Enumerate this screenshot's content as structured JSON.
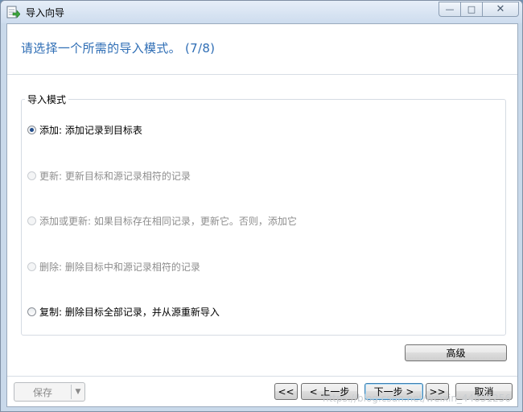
{
  "window": {
    "title": "导入向导",
    "controls": {
      "minimize": "—",
      "maximize": "□",
      "close": "✕"
    }
  },
  "heading": "请选择一个所需的导入模式。 (7/8)",
  "import_mode": {
    "group_label": "导入模式",
    "options": [
      {
        "label": "添加: 添加记录到目标表",
        "checked": true,
        "enabled": true
      },
      {
        "label": "更新: 更新目标和源记录相符的记录",
        "checked": false,
        "enabled": false
      },
      {
        "label": "添加或更新: 如果目标存在相同记录，更新它。否则，添加它",
        "checked": false,
        "enabled": false
      },
      {
        "label": "删除: 删除目标中和源记录相符的记录",
        "checked": false,
        "enabled": false
      },
      {
        "label": "复制: 删除目标全部记录，并从源重新导入",
        "checked": false,
        "enabled": true
      }
    ]
  },
  "buttons": {
    "advanced": "高级",
    "save": "保存",
    "save_arrow": "▼",
    "first": "<<",
    "prev": "< 上一步",
    "next": "下一步 >",
    "last": ">>",
    "cancel": "取消"
  },
  "watermark": "https://blog.csdn.net/weixin_44831256"
}
